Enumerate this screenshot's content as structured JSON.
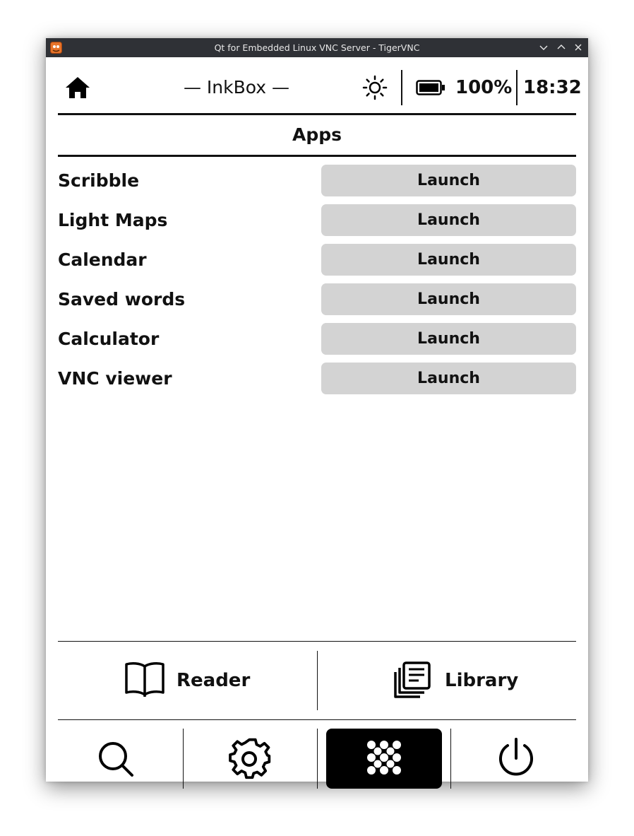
{
  "window": {
    "title": "Qt for Embedded Linux VNC Server - TigerVNC",
    "controls": [
      "minimize-icon",
      "maximize-icon",
      "close-icon"
    ]
  },
  "topbar": {
    "brand": "— InkBox —",
    "battery_percent": "100%",
    "time": "18:32",
    "icons": [
      "home-icon",
      "brightness-icon",
      "battery-full-icon"
    ]
  },
  "section": {
    "title": "Apps"
  },
  "apps": [
    {
      "name": "Scribble",
      "button": "Launch"
    },
    {
      "name": "Light Maps",
      "button": "Launch"
    },
    {
      "name": "Calendar",
      "button": "Launch"
    },
    {
      "name": "Saved words",
      "button": "Launch"
    },
    {
      "name": "Calculator",
      "button": "Launch"
    },
    {
      "name": "VNC viewer",
      "button": "Launch"
    }
  ],
  "bottom": {
    "reader_label": "Reader",
    "library_label": "Library"
  },
  "dock": {
    "items": [
      "search-icon",
      "settings-icon",
      "apps-grid-icon",
      "power-icon"
    ],
    "active": "apps-grid-icon"
  },
  "colors": {
    "titlebar": "#2f3136",
    "button_bg": "#d3d3d3",
    "text": "#111111",
    "active_dock": "#000000"
  }
}
